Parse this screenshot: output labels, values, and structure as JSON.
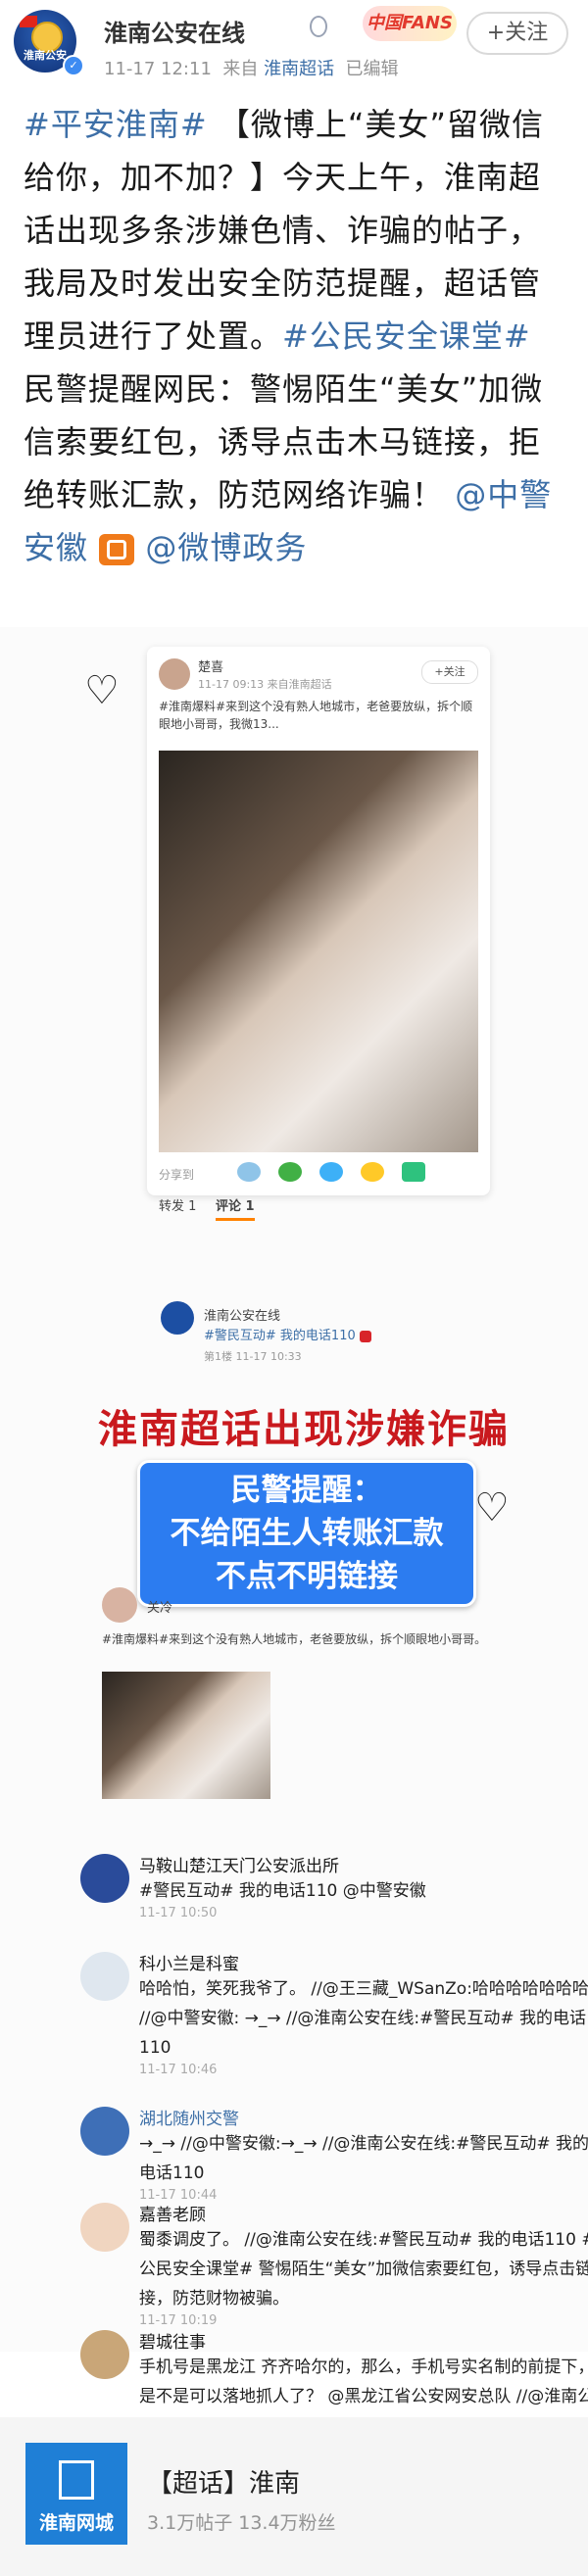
{
  "header": {
    "user_name": "淮南公安在线",
    "meta_time": "11-17 12:11",
    "meta_from": "来自",
    "meta_source": "淮南超话",
    "meta_edited": "已编辑",
    "fans_badge": "中国FANS",
    "follow_label": "+关注",
    "avatar_text": "淮南公安"
  },
  "post": {
    "topic1": "#平安淮南#",
    "body1": " 【微博上“美女”留微信给你，加不加？】今天上午，淮南超话出现多条涉嫌色情、诈骗的帖子，我局及时发出安全防范提醒，超话管理员进行了处置。",
    "topic2": "#公民安全课堂#",
    "body2": " 民警提醒网民：警惕陌生“美女”加微信索要红包，诱导点击木马链接，拒绝转账汇款，防范网络诈骗！ ",
    "mention1": "@中警安徽",
    "mention2": "@微博政务"
  },
  "screenshot": {
    "card1_name": "楚喜",
    "card1_meta": "11-17 09:13  来自淮南超话",
    "follow_small": "+关注",
    "card1_text": "#淮南爆料#来到这个没有熟人地城市，老爸要放纵，拆个顺眼地小哥哥，我微13...",
    "share_label": "分享到",
    "repost_label": "转发 1",
    "comment_label": "评论 1",
    "reply_name": "淮南公安在线",
    "reply_text": "#警民互动# 我的电话110",
    "reply_meta": "第1楼 11-17 10:33",
    "red_title": "淮南超话出现涉嫌诈骗帖",
    "warn_line1": "民警提醒：",
    "warn_line2": "不给陌生人转账汇款",
    "warn_line3": "不点不明链接",
    "card2_name": "关冷",
    "card2_text": "#淮南爆料#来到这个没有熟人地城市，老爸要放纵，拆个顺眼地小哥哥。"
  },
  "comments": [
    {
      "name": "马鞍山楚江天门公安派出所",
      "body": "#警民互动# 我的电话110 @中警安徽",
      "time": "11-17 10:50"
    },
    {
      "name": "科小兰是科蜜",
      "body": "哈哈怕，笑死我爷了。 //@王三藏_WSanZo:哈哈哈哈哈哈哈 //@中警安徽: →_→ //@淮南公安在线:#警民互动# 我的电话110",
      "time": "11-17 10:46"
    },
    {
      "name": "湖北随州交警",
      "body": "→_→ //@中警安徽:→_→ //@淮南公安在线:#警民互动# 我的电话110",
      "time": "11-17 10:44"
    },
    {
      "name": "嘉善老顾",
      "body": "蜀黍调皮了。 //@淮南公安在线:#警民互动# 我的电话110 #公民安全课堂# 警惕陌生“美女”加微信索要红包，诱导点击链接，防范财物被骗。",
      "time": "11-17 10:19"
    },
    {
      "name": "碧城往事",
      "body": "手机号是黑龙江 齐齐哈尔的，那么，手机号实名制的前提下，是不是可以落地抓人了？ @黑龙江省公安网安总队 //@淮南公安在线:#警民互动# 我",
      "time": ""
    }
  ],
  "chaohua": {
    "title": "【超话】淮南",
    "stats": "3.1万帖子 13.4万粉丝",
    "logo_text": "淮南网城"
  }
}
